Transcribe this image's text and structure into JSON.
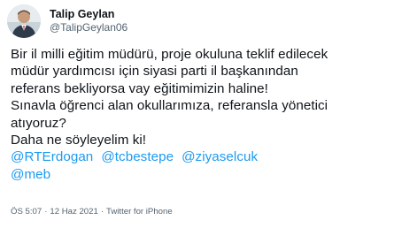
{
  "author": {
    "display_name": "Talip Geylan",
    "handle": "@TalipGeylan06"
  },
  "tweet": {
    "lines": [
      "Bir il milli eğitim müdürü, proje okuluna teklif edilecek",
      "müdür yardımcısı için siyasi parti il başkanından",
      "referans bekliyorsa vay eğitimimizin haline!",
      "Sınavla öğrenci alan okullarımıza, referansla yönetici",
      "atıyoruz?",
      "Daha ne söyleyelim ki!"
    ],
    "mentions_row1": [
      "@RTErdogan",
      "@tcbestepe",
      "@ziyaselcuk"
    ],
    "mentions_row2": [
      "@meb"
    ]
  },
  "meta": {
    "time": "ÖS 5:07",
    "separator": "·",
    "date": "12 Haz 2021",
    "source": "Twitter for iPhone"
  },
  "colors": {
    "text": "#0f1419",
    "secondary": "#536471",
    "link": "#1d9bf0",
    "background": "#ffffff"
  }
}
